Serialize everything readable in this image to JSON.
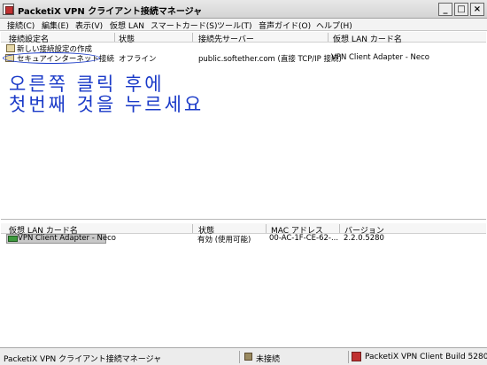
{
  "window": {
    "title": "PacketiX VPN クライアント接続マネージャ",
    "min_glyph": "_",
    "max_glyph": "□",
    "close_glyph": "×"
  },
  "menu": [
    "接続(C)",
    "編集(E)",
    "表示(V)",
    "仮想 LAN",
    "スマートカード(S)",
    "ツール(T)",
    "音声ガイド(O)",
    "ヘルプ(H)"
  ],
  "connections": {
    "columns": [
      "接続設定名",
      "状態",
      "接続先サーバー",
      "仮想 LAN カード名"
    ],
    "rows": [
      {
        "name": "新しい接続設定の作成",
        "icon": "new-connection-icon",
        "status": "",
        "server": "",
        "adapter": ""
      },
      {
        "name": "セキュアインターネット接続",
        "icon": "connection-icon",
        "status": "オフライン",
        "server": "public.softether.com (直接 TCP/IP 接続)",
        "adapter": "VPN Client Adapter - Neco"
      }
    ]
  },
  "annotation": {
    "line1": "오른쪽 클릭 후에",
    "line2": "첫번째 것을 누르세요",
    "color": "#1a3ac8"
  },
  "adapters": {
    "columns": [
      "仮想 LAN カード名",
      "状態",
      "MAC アドレス",
      "バージョン"
    ],
    "rows": [
      {
        "name": "VPN Client Adapter - Neco",
        "icon": "network-adapter-icon",
        "status": "有効 (使用可能)",
        "mac": "00-AC-1F-CE-62-...",
        "version": "2.2.0.5280"
      }
    ]
  },
  "statusbar": {
    "left": "PacketiX VPN クライアント接続マネージャ",
    "middle": "未接続",
    "right": "PacketiX VPN Client Build 5280"
  }
}
